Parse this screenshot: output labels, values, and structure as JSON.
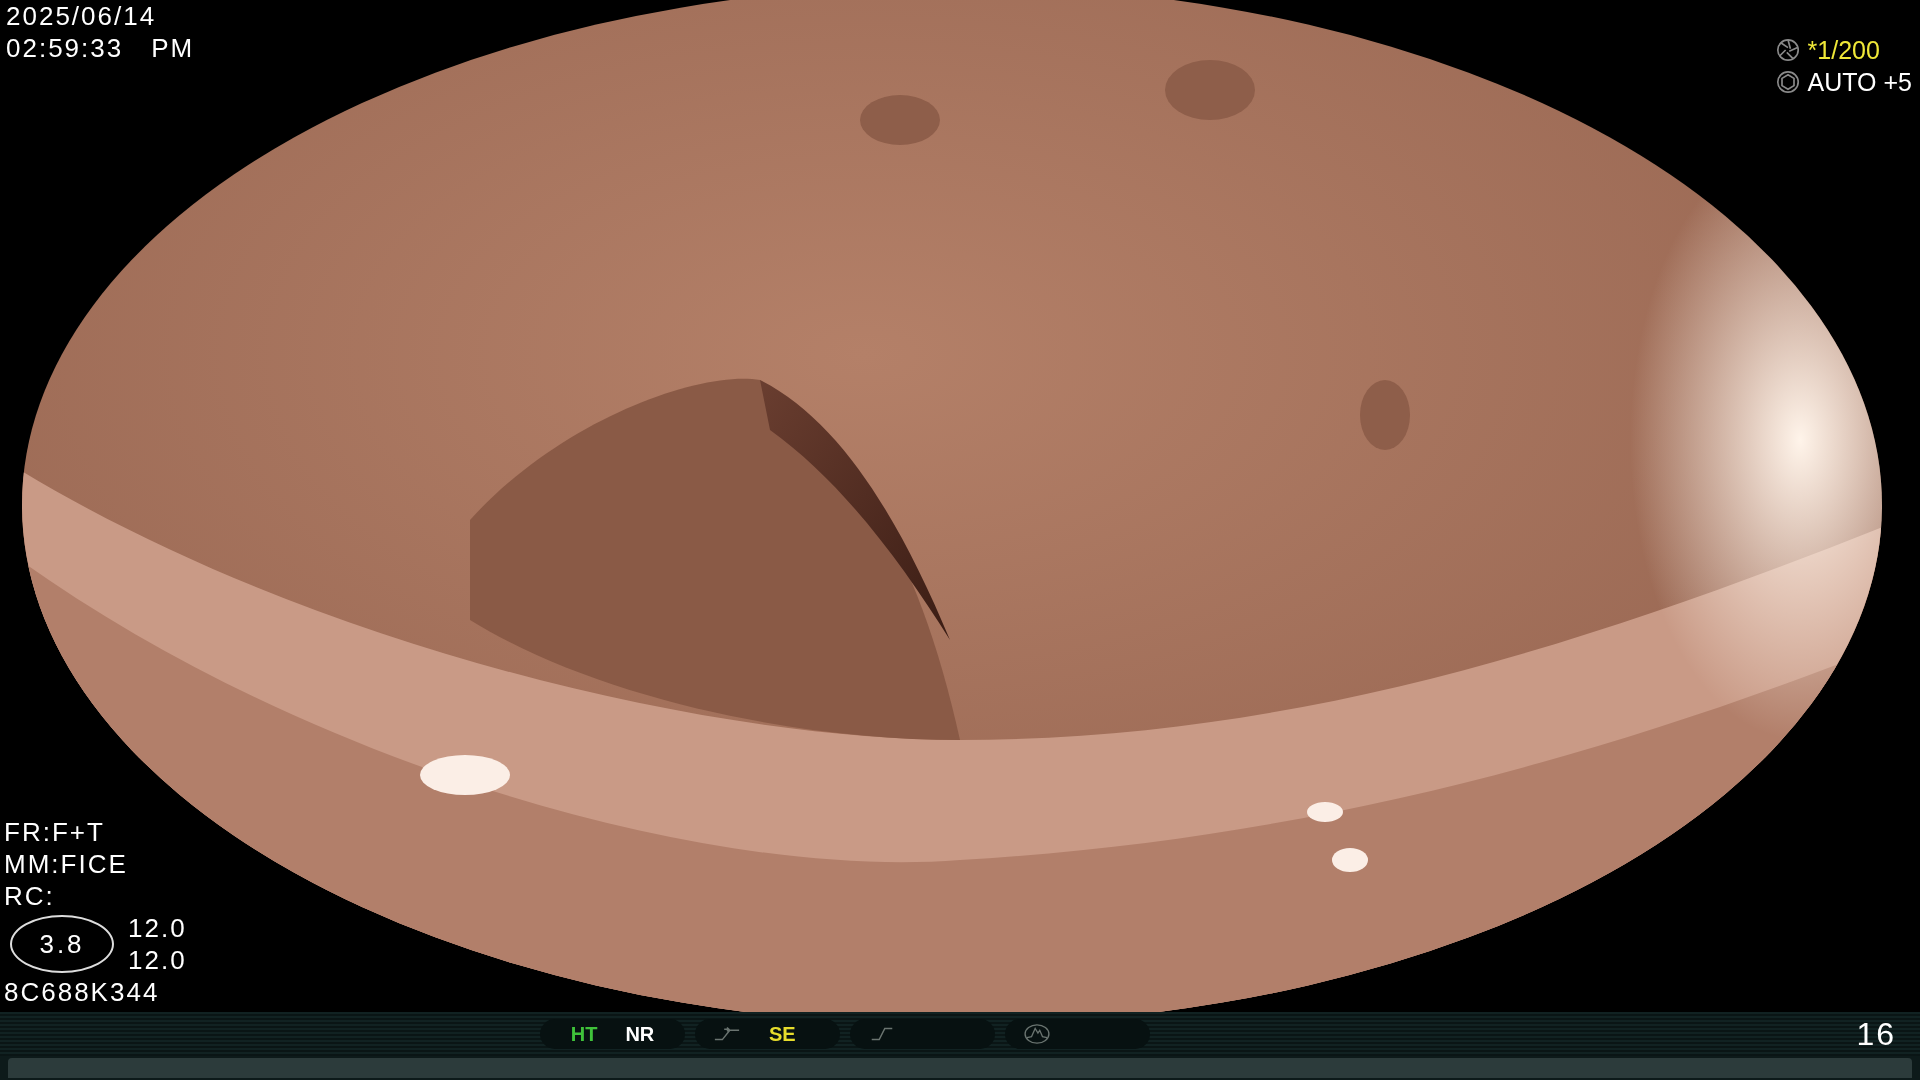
{
  "datetime": {
    "date": "2025/06/14",
    "time": "02:59:33",
    "meridiem": "PM"
  },
  "exposure": {
    "shutter": "*1/200",
    "iris": "AUTO +5"
  },
  "settings": [
    "FR:F+T",
    "MM:FICE",
    "RC:"
  ],
  "zoom_value": "3.8",
  "readings": [
    "12.0",
    "12.0"
  ],
  "scope_id": "8C688K344",
  "function_bar": [
    {
      "kind": "plain",
      "labels": [
        {
          "text": "HT",
          "color": "#3fc23a"
        },
        {
          "text": "NR",
          "color": "#ffffff"
        }
      ]
    },
    {
      "kind": "enhance",
      "labels": [
        {
          "text": "SE",
          "color": "#e6dc2c"
        }
      ]
    },
    {
      "kind": "curve"
    },
    {
      "kind": "wave"
    }
  ],
  "frame_counter": "16"
}
